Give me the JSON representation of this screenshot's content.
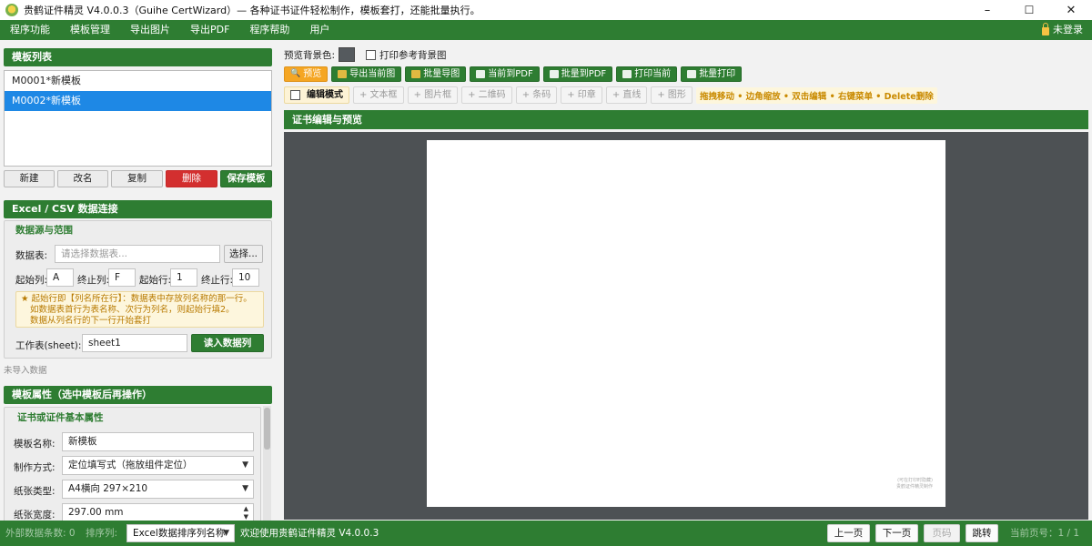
{
  "window": {
    "title": "贵鹤证件精灵 V4.0.0.3（Guihe CertWizard）— 各种证书证件轻松制作，模板套打，还能批量执行。",
    "minimize": "–",
    "maximize": "☐",
    "close": "✕"
  },
  "menu": {
    "items": [
      "程序功能",
      "模板管理",
      "导出图片",
      "导出PDF",
      "程序帮助",
      "用户"
    ],
    "login_status": "未登录"
  },
  "template_list": {
    "header": "模板列表",
    "items": [
      "M0001*新模板",
      "M0002*新模板"
    ],
    "buttons": {
      "new": "新建",
      "rename": "改名",
      "copy": "复制",
      "delete": "删除",
      "save": "保存模板"
    }
  },
  "data_connection": {
    "header": "Excel / CSV 数据连接",
    "group_label": "数据源与范围",
    "table_label": "数据表:",
    "table_placeholder": "请选择数据表...",
    "select_button": "选择...",
    "start_col_label": "起始列:",
    "start_col": "A",
    "end_col_label": "终止列:",
    "end_col": "F",
    "start_row_label": "起始行:",
    "start_row": "1",
    "end_row_label": "终止行:",
    "end_row": "10",
    "note_line1": "★ 起始行即【列名所在行】：数据表中存放列名称的那一行。",
    "note_line2": "如数据表首行为表名称、次行为列名，则起始行填2。",
    "note_line3": "数据从列名行的下一行开始套打",
    "sheet_label": "工作表(sheet):",
    "sheet_value": "sheet1",
    "read_button": "读入数据列",
    "import_status": "未导入数据"
  },
  "template_props": {
    "header": "模板属性（选中模板后再操作）",
    "group_label": "证书或证件基本属性",
    "name_label": "模板名称:",
    "name_value": "新模板",
    "method_label": "制作方式:",
    "method_value": "定位填写式（拖放组件定位）",
    "paper_type_label": "纸张类型:",
    "paper_type_value": "A4横向 297×210",
    "paper_width_label": "纸张宽度:",
    "paper_width_value": "297.00 mm"
  },
  "toolbar": {
    "bg_color_label": "预览背景色:",
    "bg_color": "#555a5e",
    "print_bg_label": "打印参考背景图",
    "preview": "预览",
    "export_current_image": "导出当前图",
    "batch_export_image": "批量导图",
    "current_to_pdf": "当前到PDF",
    "batch_to_pdf": "批量到PDF",
    "print_current": "打印当前",
    "batch_print": "批量打印",
    "edit_mode": "编辑模式",
    "add_textbox": "+ 文本框",
    "add_image": "+ 图片框",
    "add_qrcode": "+ 二维码",
    "add_barcode": "+ 条码",
    "add_seal": "+ 印章",
    "add_line": "+ 直线",
    "add_shape": "+ 图形",
    "tip": "拖拽移动 • 边角缩放 • 双击编辑 • 右键菜单 • Delete删除"
  },
  "preview": {
    "header": "证书编辑与预览",
    "watermark_line1": "(可在打印时隐藏)",
    "watermark_line2": "贵鹤证件精灵制作"
  },
  "status": {
    "record_count": "外部数据条数: 0",
    "sort_label": "排序列:",
    "sort_value": "Excel数据排序列名称",
    "welcome": "欢迎使用贵鹤证件精灵 V4.0.0.3",
    "prev_page": "上一页",
    "next_page": "下一页",
    "page_input": "页码",
    "jump": "跳转",
    "current_page": "当前页号：1 / 1"
  },
  "colors": {
    "accent": "#2e7d32",
    "selection": "#1e88e5",
    "danger": "#d32f2f",
    "gold": "#f5a623"
  }
}
